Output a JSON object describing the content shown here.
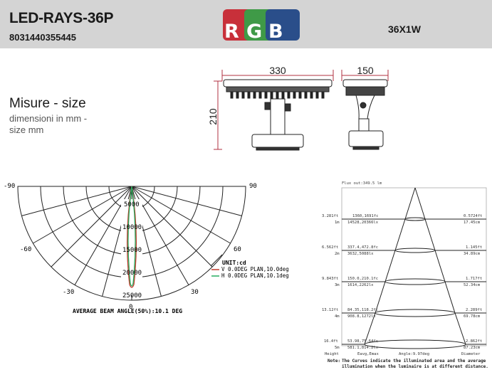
{
  "header": {
    "title": "LED-RAYS-36P",
    "code": "8031440355445",
    "rgb_letters": [
      "R",
      "G",
      "B"
    ],
    "rgb_colors": [
      "#c8303a",
      "#3f9a47",
      "#2a4e8a"
    ],
    "power": "36X1W"
  },
  "misure": {
    "title": "Misure - size",
    "subtitle_line1": "dimensioni in mm -",
    "subtitle_line2": "size mm"
  },
  "dimensions": {
    "width_front": "330",
    "width_side": "150",
    "height": "210"
  },
  "polar_chart": {
    "angle_labels": {
      "neg90": "-90",
      "pos90": "90",
      "neg60": "-60",
      "pos60": "60",
      "neg30": "-30",
      "pos30": "30",
      "zero": "0"
    },
    "radial_labels": [
      "5000",
      "10000",
      "15000",
      "20000",
      "25000"
    ],
    "unit_label": "UNIT:cd",
    "legend": [
      {
        "label": "V 0.0DEG PLAN,10.0deg",
        "color": "#c0392b"
      },
      {
        "label": "H 0.0DEG PLAN,10.1deg",
        "color": "#27ae60"
      }
    ],
    "beam_angle": "AVERAGE BEAM ANGLE(50%):10.1 DEG"
  },
  "cone_chart": {
    "flux_label": "Flux out:349.5 lm",
    "rows": [
      {
        "height_ft": "3.281ft",
        "height_m": "1m",
        "eavg": "1360,1691fc",
        "emax": "14528,20366lx",
        "diam_ft": "0.5724ft",
        "diam_m": "17.45cm"
      },
      {
        "height_ft": "6.562ft",
        "height_m": "2m",
        "eavg": "337.4,472.8fc",
        "emax": "3632,5088lx",
        "diam_ft": "1.145ft",
        "diam_m": "34.89cm"
      },
      {
        "height_ft": "9.843ft",
        "height_m": "3m",
        "eavg": "150.0,210.1fc",
        "emax": "1614,2262lx",
        "diam_ft": "1.717ft",
        "diam_m": "52.34cm"
      },
      {
        "height_ft": "13.12ft",
        "height_m": "4m",
        "eavg": "84.35,118.2fc",
        "emax": "908.8,1272lx",
        "diam_ft": "2.289ft",
        "diam_m": "69.78cm"
      },
      {
        "height_ft": "16.4ft",
        "height_m": "5m",
        "eavg": "53.98,75.64fc",
        "emax": "581.1,814.2lx",
        "diam_ft": "2.862ft",
        "diam_m": "87.23cm"
      }
    ],
    "footer": {
      "height": "Height",
      "eavg": "Eavg,Emax",
      "angle": "Angle:9.97deg",
      "diameter": "Diameter"
    },
    "note_prefix": "Note:",
    "note_line1": "The Curves indicate the illuminated area and the average",
    "note_line2": "illumination when the luminaire is at different distance."
  }
}
